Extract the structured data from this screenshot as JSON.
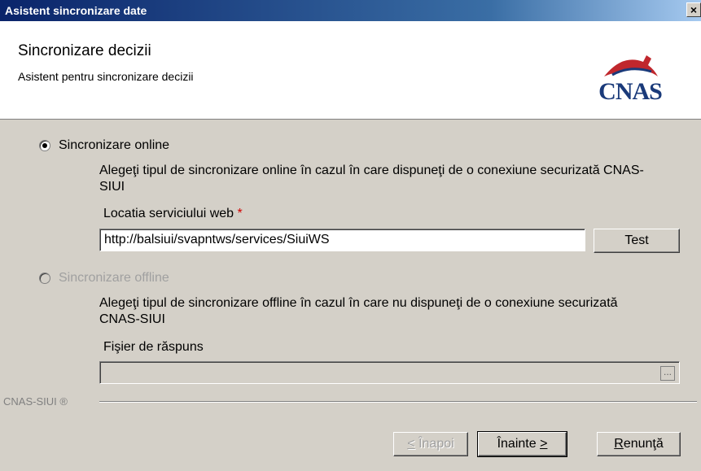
{
  "window": {
    "title": "Asistent sincronizare date",
    "close_label": "×"
  },
  "header": {
    "title": "Sincronizare decizii",
    "subtitle": "Asistent pentru sincronizare decizii",
    "logo_text": "CNAS"
  },
  "online": {
    "label": "Sincronizare online",
    "selected": true,
    "description": "Alegeţi tipul de sincronizare online în cazul în care dispuneţi de o conexiune securizată CNAS-SIUI",
    "field_label": "Locatia serviciului web",
    "required_mark": "*",
    "url_value": "http://balsiui/svapntws/services/SiuiWS",
    "test_button": "Test"
  },
  "offline": {
    "label": "Sincronizare offline",
    "selected": false,
    "description": "Alegeţi tipul de sincronizare offline în cazul în care nu dispuneţi de o conexiune securizată CNAS-SIUI",
    "field_label": "Fişier de răspuns",
    "file_value": "",
    "browse_label": "..."
  },
  "footer": {
    "brand": "CNAS-SIUI ®",
    "back_button": {
      "mnemonic": "<",
      "label": " Înapoi"
    },
    "next_button": {
      "label": "Înainte ",
      "mnemonic": ">"
    },
    "cancel_button": {
      "mnemonic": "R",
      "label": "enunţă"
    }
  },
  "colors": {
    "titlebar": "#0a246a",
    "dialog": "#d4d0c8",
    "required": "#d00000",
    "logo": "#1a3a7a"
  }
}
